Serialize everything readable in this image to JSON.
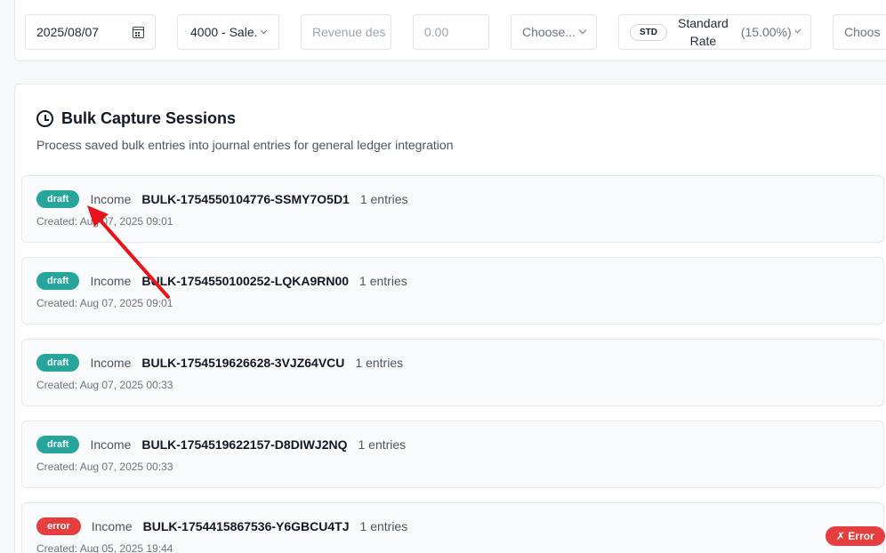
{
  "form": {
    "date": "2025/08/07",
    "account": "4000 - Sale...",
    "description_placeholder": "Revenue des",
    "amount_placeholder": "0.00",
    "choose_1": "Choose...",
    "vat_code": "STD",
    "vat_name": "Standard Rate",
    "vat_rate": "(15.00%)",
    "choose_2": "Choos"
  },
  "sessions": {
    "title": "Bulk Capture Sessions",
    "description": "Process saved bulk entries into journal entries for general ledger integration",
    "items": [
      {
        "status": "draft",
        "type": "Income",
        "id": "BULK-1754550104776-SSMY7O5D1",
        "count": "1 entries",
        "created": "Created: Aug 07, 2025 09:01"
      },
      {
        "status": "draft",
        "type": "Income",
        "id": "BULK-1754550100252-LQKA9RN00",
        "count": "1 entries",
        "created": "Created: Aug 07, 2025 09:01"
      },
      {
        "status": "draft",
        "type": "Income",
        "id": "BULK-1754519626628-3VJZ64VCU",
        "count": "1 entries",
        "created": "Created: Aug 07, 2025 00:33"
      },
      {
        "status": "draft",
        "type": "Income",
        "id": "BULK-1754519622157-D8DIWJ2NQ",
        "count": "1 entries",
        "created": "Created: Aug 07, 2025 00:33"
      },
      {
        "status": "error",
        "type": "Income",
        "id": "BULK-1754415867536-Y6GBCU4TJ",
        "count": "1 entries",
        "created": "Created: Aug 05, 2025 19:44"
      }
    ],
    "error_button": "✗ Error"
  },
  "colors": {
    "draft": "#26a69a",
    "error": "#e53e3e",
    "annotation_arrow": "#e8141b"
  }
}
